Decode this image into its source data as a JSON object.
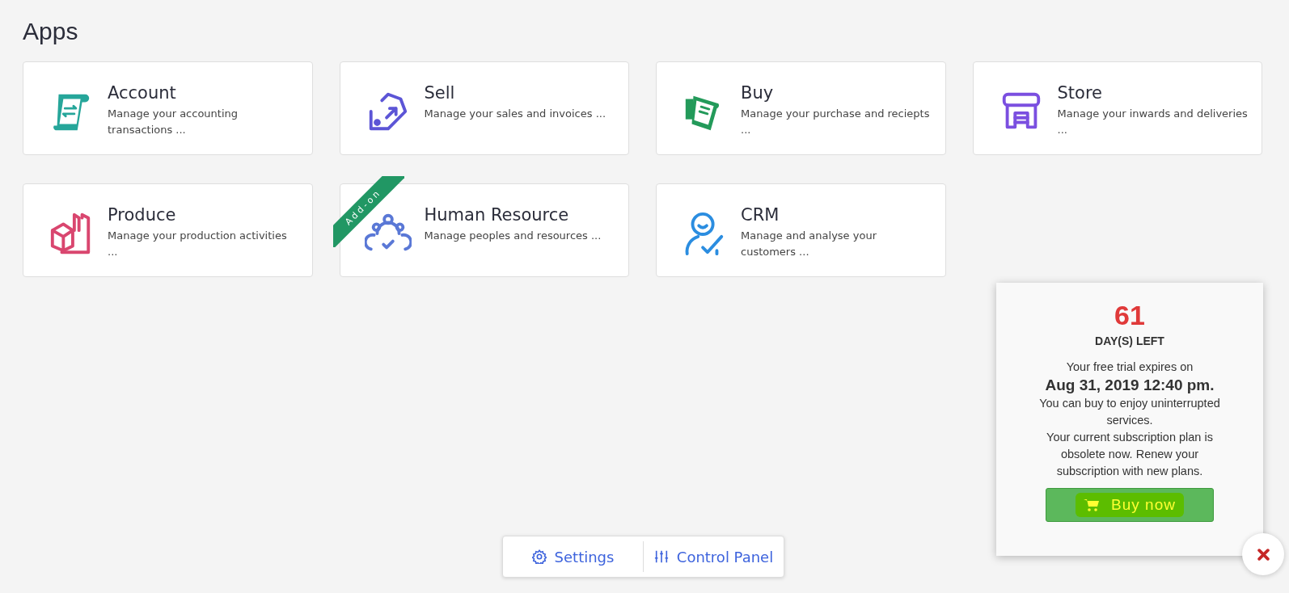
{
  "page_title": "Apps",
  "apps": [
    {
      "name": "Account",
      "description": "Manage your accounting transactions ...",
      "kind": "scroll",
      "color": "#26a69a"
    },
    {
      "name": "Sell",
      "description": "Manage your sales and invoices ...",
      "kind": "tag",
      "color": "#5c55d6"
    },
    {
      "name": "Buy",
      "description": "Manage your purchase and reciepts ...",
      "kind": "receipt",
      "color": "#239a5a"
    },
    {
      "name": "Store",
      "description": "Manage your inwards and deliveries ...",
      "kind": "store",
      "color": "#7b4fe0"
    },
    {
      "name": "Produce",
      "description": "Manage your production activities ...",
      "kind": "factory",
      "color": "#d9466f"
    },
    {
      "name": "Human Resource",
      "description": "Manage peoples and resources ...",
      "kind": "people",
      "color": "#5a78d6",
      "ribbon": "Add-on"
    },
    {
      "name": "CRM",
      "description": "Manage and analyse your customers ...",
      "kind": "person",
      "color": "#2b8de0"
    }
  ],
  "trial": {
    "days": "61",
    "days_label": "DAY(S) LEFT",
    "expires_text": "Your free trial expires on",
    "expiry": "Aug 31, 2019 12:40 pm.",
    "message": "You can buy to enjoy uninterrupted services.",
    "notice": "Your current subscription plan is obsolete now. Renew your subscription with new plans.",
    "button": "Buy now"
  },
  "bottom_bar": [
    {
      "label": "Settings",
      "kind": "settings"
    },
    {
      "label": "Control Panel",
      "kind": "control_panel"
    }
  ]
}
